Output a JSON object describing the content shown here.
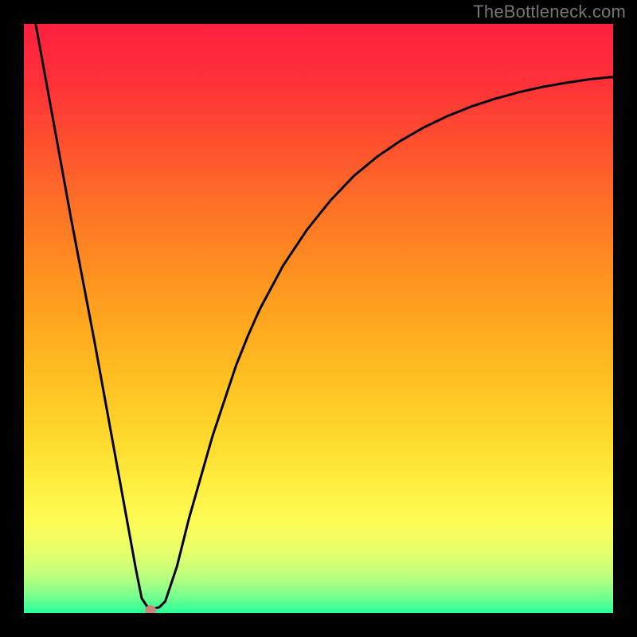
{
  "watermark": "TheBottleneck.com",
  "chart_data": {
    "type": "line",
    "title": "",
    "xlabel": "",
    "ylabel": "",
    "xlim": [
      0,
      100
    ],
    "ylim": [
      0,
      100
    ],
    "grid": false,
    "legend": false,
    "series": [
      {
        "name": "bottleneck-curve",
        "color": "#000000",
        "x": [
          2,
          4,
          6,
          8,
          10,
          12,
          14,
          16,
          18,
          19,
          20,
          21,
          22,
          23,
          24,
          26,
          28,
          30,
          32,
          34,
          36,
          38,
          40,
          44,
          48,
          52,
          56,
          60,
          64,
          68,
          72,
          76,
          80,
          84,
          88,
          92,
          96,
          100
        ],
        "y": [
          100,
          89,
          78,
          67,
          56.5,
          46,
          35,
          24,
          13,
          7.5,
          2.5,
          1,
          0.8,
          1,
          2,
          8,
          16,
          23,
          30,
          36,
          42,
          47,
          51.5,
          59,
          65,
          70,
          74.2,
          77.5,
          80.2,
          82.5,
          84.4,
          86,
          87.3,
          88.4,
          89.3,
          90,
          90.6,
          91
        ]
      }
    ],
    "marker": {
      "name": "optimal-point",
      "x": 21.5,
      "y": 0.5,
      "color": "#C7867B"
    },
    "background_gradient": {
      "direction": "vertical-top-to-bottom",
      "stops": [
        {
          "offset": 0.0,
          "color": "#FF1F3F"
        },
        {
          "offset": 0.1,
          "color": "#FF3138"
        },
        {
          "offset": 0.2,
          "color": "#FF4F2F"
        },
        {
          "offset": 0.3,
          "color": "#FF6E27"
        },
        {
          "offset": 0.4,
          "color": "#FF8A21"
        },
        {
          "offset": 0.5,
          "color": "#FFA51E"
        },
        {
          "offset": 0.6,
          "color": "#FFBF21"
        },
        {
          "offset": 0.7,
          "color": "#FFD82C"
        },
        {
          "offset": 0.78,
          "color": "#FFEE3F"
        },
        {
          "offset": 0.85,
          "color": "#FCFC57"
        },
        {
          "offset": 0.9,
          "color": "#E4FF6C"
        },
        {
          "offset": 0.94,
          "color": "#B8FF7F"
        },
        {
          "offset": 0.97,
          "color": "#7AFF8E"
        },
        {
          "offset": 1.0,
          "color": "#27FF99"
        }
      ]
    }
  }
}
